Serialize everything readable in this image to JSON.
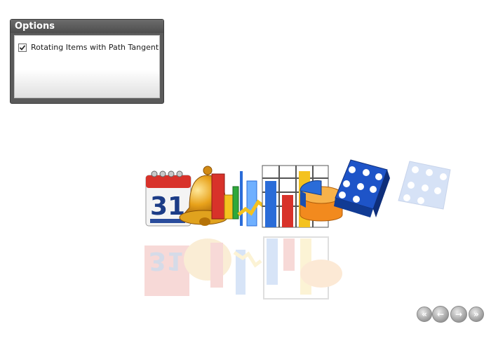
{
  "options": {
    "title": "Options",
    "rotating_label": "Rotating Items with Path Tangent",
    "rotating_checked": true
  },
  "carousel": {
    "items": [
      {
        "name": "calendar-icon",
        "text": "31"
      },
      {
        "name": "bell-icon"
      },
      {
        "name": "bar-chart-icon"
      },
      {
        "name": "line-chart-icon"
      },
      {
        "name": "column-chart-icon"
      },
      {
        "name": "pie-chart-icon"
      },
      {
        "name": "dice-icon"
      },
      {
        "name": "dice-faded-icon"
      }
    ],
    "colors": {
      "blue": "#2a6cd8",
      "red": "#d8322a",
      "yellow": "#f4c21f",
      "orange": "#f28a1e",
      "green": "#2ea83a"
    }
  },
  "navigation": {
    "first_icon": "double-left-icon",
    "prev_icon": "left-arrow-icon",
    "next_icon": "right-arrow-icon",
    "last_icon": "double-right-icon"
  }
}
